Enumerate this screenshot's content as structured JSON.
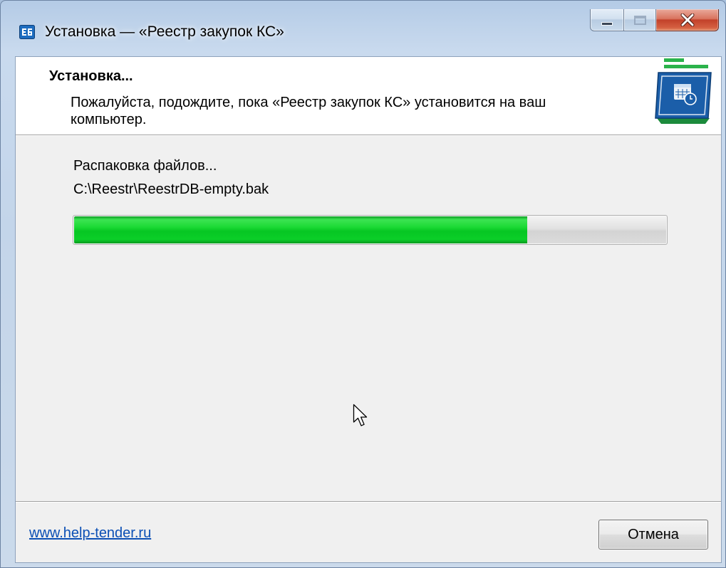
{
  "window": {
    "title": "Установка — «Реестр закупок КС»",
    "title_icon": "app-icon",
    "caption_buttons": {
      "minimize_icon": "minimize-icon",
      "maximize_icon": "maximize-icon",
      "close_icon": "close-icon"
    }
  },
  "header": {
    "title": "Установка...",
    "subtitle_lines": [
      "Пожалуйста, подождите, пока «Реестр закупок КС» установится на ваш",
      "компьютер."
    ],
    "logo_icon": "app-logo-icon"
  },
  "status": {
    "action": "Распаковка файлов...",
    "current_file": "C:\\Reestr\\ReestrDB-empty.bak"
  },
  "progress": {
    "fraction": 0.765
  },
  "footer": {
    "link_text": "www.help-tender.ru",
    "cancel_label": "Отмена"
  },
  "colors": {
    "progress_fill": "#06c623",
    "link": "#0b4fb5",
    "close_button": "#c2412a",
    "title_bar": "#c3d5ea"
  }
}
